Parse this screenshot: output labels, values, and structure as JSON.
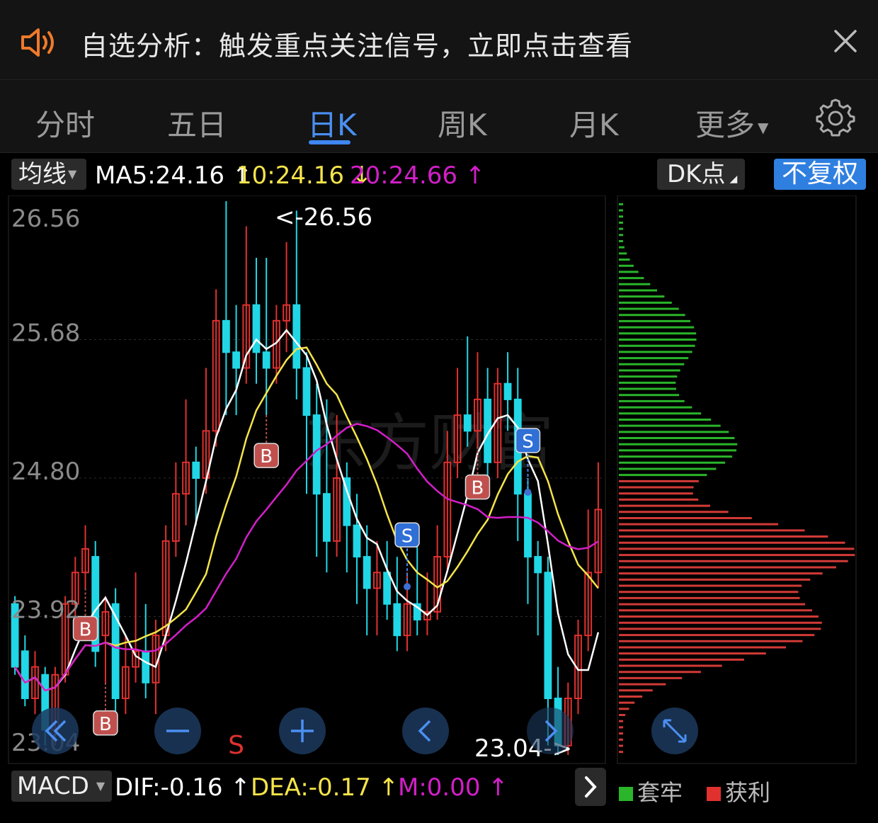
{
  "notification": {
    "text": "自选分析：触发重点关注信号，立即点击查看"
  },
  "tabs": [
    {
      "label": "分时",
      "active": false
    },
    {
      "label": "五日",
      "active": false
    },
    {
      "label": "日K",
      "active": true
    },
    {
      "label": "周K",
      "active": false
    },
    {
      "label": "月K",
      "active": false
    },
    {
      "label": "更多",
      "active": false
    }
  ],
  "ma_bar": {
    "selector": "均线",
    "ma5": "MA5:24.16",
    "ma10": "10:24.16",
    "ma20": "20:24.66",
    "dk_button": "DK点",
    "adjust_button": "不复权"
  },
  "colors": {
    "up": "#e0312f",
    "down": "#21d7e6",
    "ma5": "#ffffff",
    "ma10": "#f5e44a",
    "ma20": "#d21fc8",
    "accent": "#3f86f0"
  },
  "chart_data": {
    "type": "candlestick",
    "y_ticks": [
      "26.56",
      "25.68",
      "24.80",
      "23.92",
      "23.04"
    ],
    "ylim": [
      23.04,
      26.56
    ],
    "high_label": "<-26.56",
    "low_label": "23.04->",
    "watermark": "东方财富",
    "signals": [
      {
        "label": "B",
        "type": "buy",
        "candle": 7
      },
      {
        "label": "B",
        "type": "buy",
        "candle": 9
      },
      {
        "label": "S",
        "type": "sell",
        "candle": 22,
        "style": "text"
      },
      {
        "label": "B",
        "type": "buy",
        "candle": 25
      },
      {
        "label": "S",
        "type": "sell",
        "candle": 39
      },
      {
        "label": "B",
        "type": "buy",
        "candle": 46
      },
      {
        "label": "S",
        "type": "sell",
        "candle": 51
      }
    ],
    "candles": [
      [
        24.0,
        23.6,
        24.05,
        23.55
      ],
      [
        23.7,
        23.4,
        23.8,
        23.35
      ],
      [
        23.4,
        23.6,
        23.7,
        23.3
      ],
      [
        23.55,
        23.2,
        23.6,
        23.1
      ],
      [
        23.2,
        23.55,
        23.6,
        23.1
      ],
      [
        23.55,
        24.0,
        24.05,
        23.5
      ],
      [
        24.0,
        24.2,
        24.3,
        23.9
      ],
      [
        24.2,
        24.35,
        24.5,
        24.1
      ],
      [
        24.3,
        23.7,
        24.4,
        23.6
      ],
      [
        23.8,
        23.95,
        24.05,
        23.5
      ],
      [
        24.0,
        23.4,
        24.1,
        23.2
      ],
      [
        23.4,
        23.6,
        23.8,
        23.3
      ],
      [
        23.6,
        23.7,
        24.2,
        23.5
      ],
      [
        23.7,
        23.5,
        24.0,
        23.4
      ],
      [
        23.5,
        23.8,
        23.9,
        23.3
      ],
      [
        23.8,
        24.4,
        24.5,
        23.7
      ],
      [
        24.4,
        24.7,
        24.9,
        24.3
      ],
      [
        24.7,
        24.9,
        25.3,
        24.5
      ],
      [
        24.9,
        24.8,
        25.0,
        24.5
      ],
      [
        24.8,
        25.1,
        25.5,
        24.7
      ],
      [
        25.1,
        25.8,
        26.0,
        25.0
      ],
      [
        25.8,
        25.6,
        26.56,
        25.2
      ],
      [
        25.6,
        25.5,
        25.9,
        25.2
      ],
      [
        25.5,
        25.9,
        26.4,
        25.4
      ],
      [
        25.9,
        25.6,
        26.2,
        25.4
      ],
      [
        25.6,
        25.5,
        26.2,
        25.2
      ],
      [
        25.5,
        25.8,
        25.9,
        25.4
      ],
      [
        25.8,
        25.9,
        26.3,
        25.6
      ],
      [
        25.9,
        25.5,
        26.5,
        25.3
      ],
      [
        25.5,
        25.2,
        25.6,
        24.7
      ],
      [
        25.2,
        24.7,
        25.4,
        24.3
      ],
      [
        24.7,
        24.4,
        25.3,
        24.2
      ],
      [
        24.4,
        24.8,
        25.2,
        24.3
      ],
      [
        24.8,
        24.5,
        24.9,
        24.2
      ],
      [
        24.5,
        24.3,
        24.7,
        24.0
      ],
      [
        24.3,
        24.1,
        24.5,
        23.8
      ],
      [
        24.1,
        24.2,
        24.4,
        23.8
      ],
      [
        24.2,
        24.0,
        24.4,
        23.9
      ],
      [
        24.0,
        23.8,
        24.3,
        23.7
      ],
      [
        23.8,
        24.0,
        24.2,
        23.7
      ],
      [
        24.0,
        23.9,
        24.4,
        23.8
      ],
      [
        23.9,
        23.95,
        24.2,
        23.8
      ],
      [
        23.95,
        24.3,
        24.5,
        23.9
      ],
      [
        24.3,
        24.9,
        25.1,
        24.2
      ],
      [
        24.9,
        25.2,
        25.5,
        24.8
      ],
      [
        25.2,
        25.1,
        25.7,
        25.0
      ],
      [
        25.1,
        25.3,
        25.6,
        25.0
      ],
      [
        25.3,
        24.9,
        25.5,
        24.7
      ],
      [
        24.9,
        25.4,
        25.5,
        24.8
      ],
      [
        25.4,
        25.3,
        25.6,
        25.1
      ],
      [
        25.3,
        24.7,
        25.5,
        24.4
      ],
      [
        24.7,
        24.3,
        24.8,
        24.0
      ],
      [
        24.3,
        24.2,
        24.4,
        23.8
      ],
      [
        24.2,
        23.4,
        24.3,
        23.1
      ],
      [
        23.4,
        23.1,
        23.6,
        23.04
      ],
      [
        23.1,
        23.4,
        23.5,
        23.04
      ],
      [
        23.4,
        23.8,
        23.9,
        23.3
      ],
      [
        23.8,
        24.2,
        24.6,
        23.7
      ],
      [
        24.2,
        24.6,
        24.9,
        24.1
      ]
    ],
    "volume_profile": {
      "label_trapped": "套牢",
      "label_profit": "获利",
      "split_price": 24.8
    }
  },
  "macd_bar": {
    "selector": "MACD",
    "dif": "DIF:-0.16",
    "dea": "DEA:-0.17",
    "m": "M:0.00"
  }
}
